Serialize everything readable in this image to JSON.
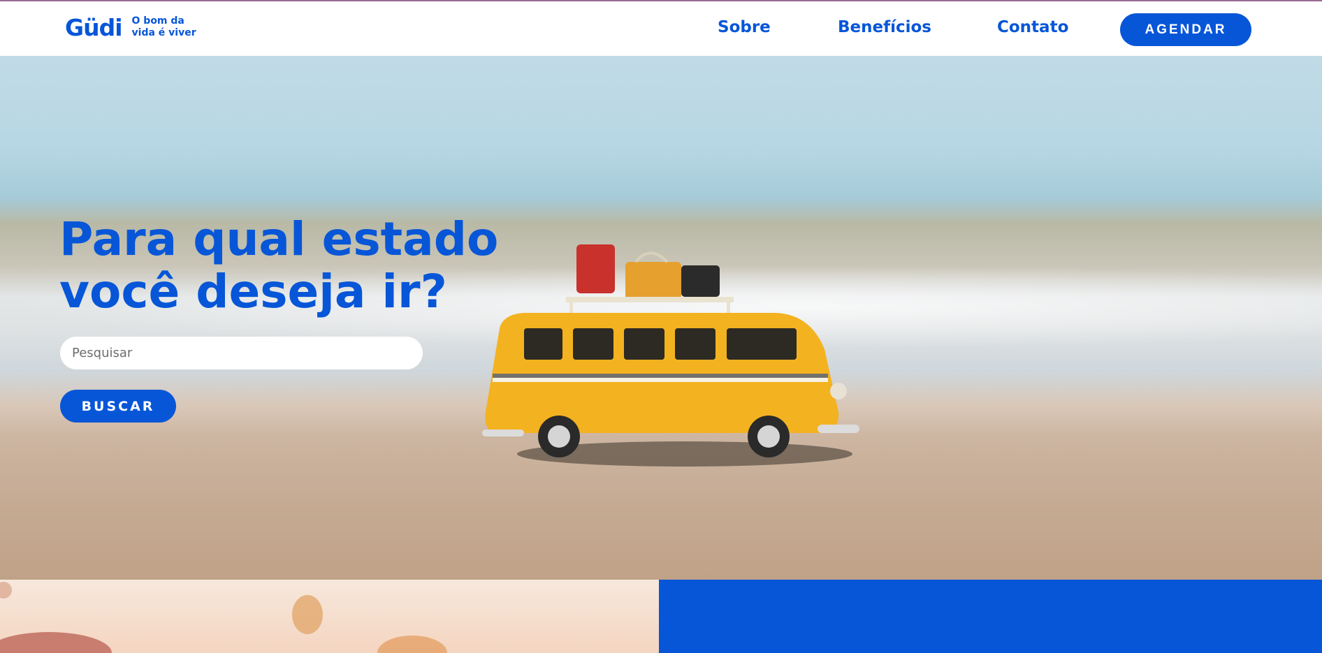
{
  "header": {
    "logo_text": "Güdi",
    "tagline": "O bom da vida é viver",
    "nav": {
      "sobre": "Sobre",
      "beneficios": "Benefícios",
      "contato": "Contato"
    },
    "cta_label": "AGENDAR"
  },
  "hero": {
    "title": "Para qual estado você deseja ir?",
    "search_placeholder": "Pesquisar",
    "search_button": "BUSCAR"
  },
  "colors": {
    "brand_blue": "#0756d8",
    "white": "#ffffff"
  }
}
